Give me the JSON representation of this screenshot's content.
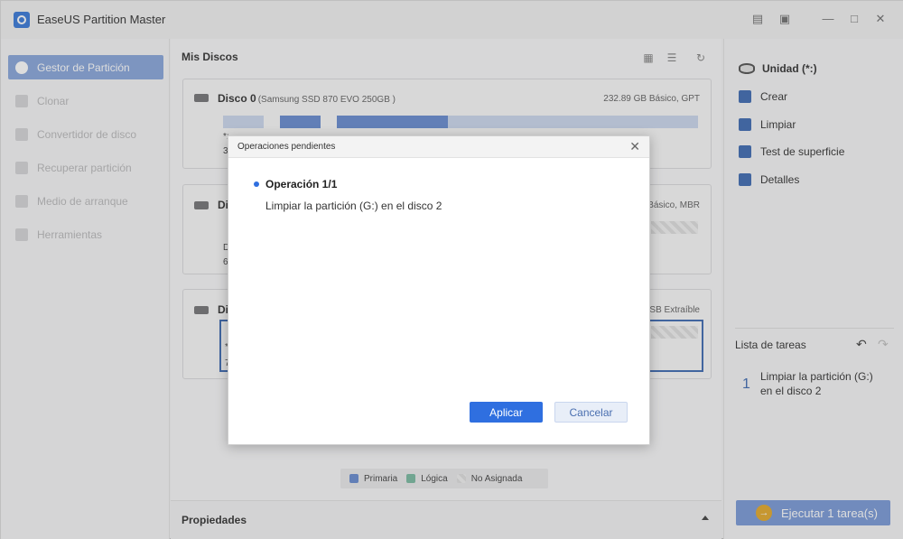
{
  "app": {
    "title": "EaseUS Partition Master"
  },
  "sidebar": {
    "items": [
      {
        "label": "Gestor de Partición",
        "active": true
      },
      {
        "label": "Clonar"
      },
      {
        "label": "Convertidor de disco"
      },
      {
        "label": "Recuperar partición"
      },
      {
        "label": "Medio de arranque"
      },
      {
        "label": "Herramientas"
      }
    ]
  },
  "main": {
    "title": "Mis Discos",
    "disks": [
      {
        "name": "Disco 0",
        "model": "(Samsung SSD 870 EVO 250GB )",
        "info": "232.89 GB Básico, GPT",
        "partition_labels": [
          "*:",
          "3"
        ]
      },
      {
        "name": "Di",
        "info": "Básico, MBR",
        "partition_labels": [
          "D",
          "6"
        ]
      },
      {
        "name": "Di",
        "info": "USB Extraíble",
        "partition_labels": [
          "*",
          "7"
        ]
      }
    ],
    "legend": [
      {
        "label": "Primaria",
        "color": "#5b82cc"
      },
      {
        "label": "Lógica",
        "color": "#6fb59a"
      },
      {
        "label": "No Asignada",
        "color": "#e0e0e0"
      }
    ],
    "properties_label": "Propiedades"
  },
  "right_panel": {
    "drive_label": "Unidad (*:)",
    "actions": [
      {
        "label": "Crear",
        "icon": "grid-plus-icon"
      },
      {
        "label": "Limpiar",
        "icon": "eraser-icon"
      },
      {
        "label": "Test de superficie",
        "icon": "scan-icon"
      },
      {
        "label": "Detalles",
        "icon": "document-icon"
      }
    ],
    "task_list_title": "Lista de tareas",
    "tasks": [
      {
        "number": "1",
        "text": "Limpiar la partición (G:) en el disco 2"
      }
    ],
    "execute_label": "Ejecutar 1 tarea(s)"
  },
  "dialog": {
    "title": "Operaciones pendientes",
    "operation_title": "Operación 1/1",
    "operation_desc": "Limpiar la partición (G:) en el disco 2",
    "apply_label": "Aplicar",
    "cancel_label": "Cancelar"
  }
}
